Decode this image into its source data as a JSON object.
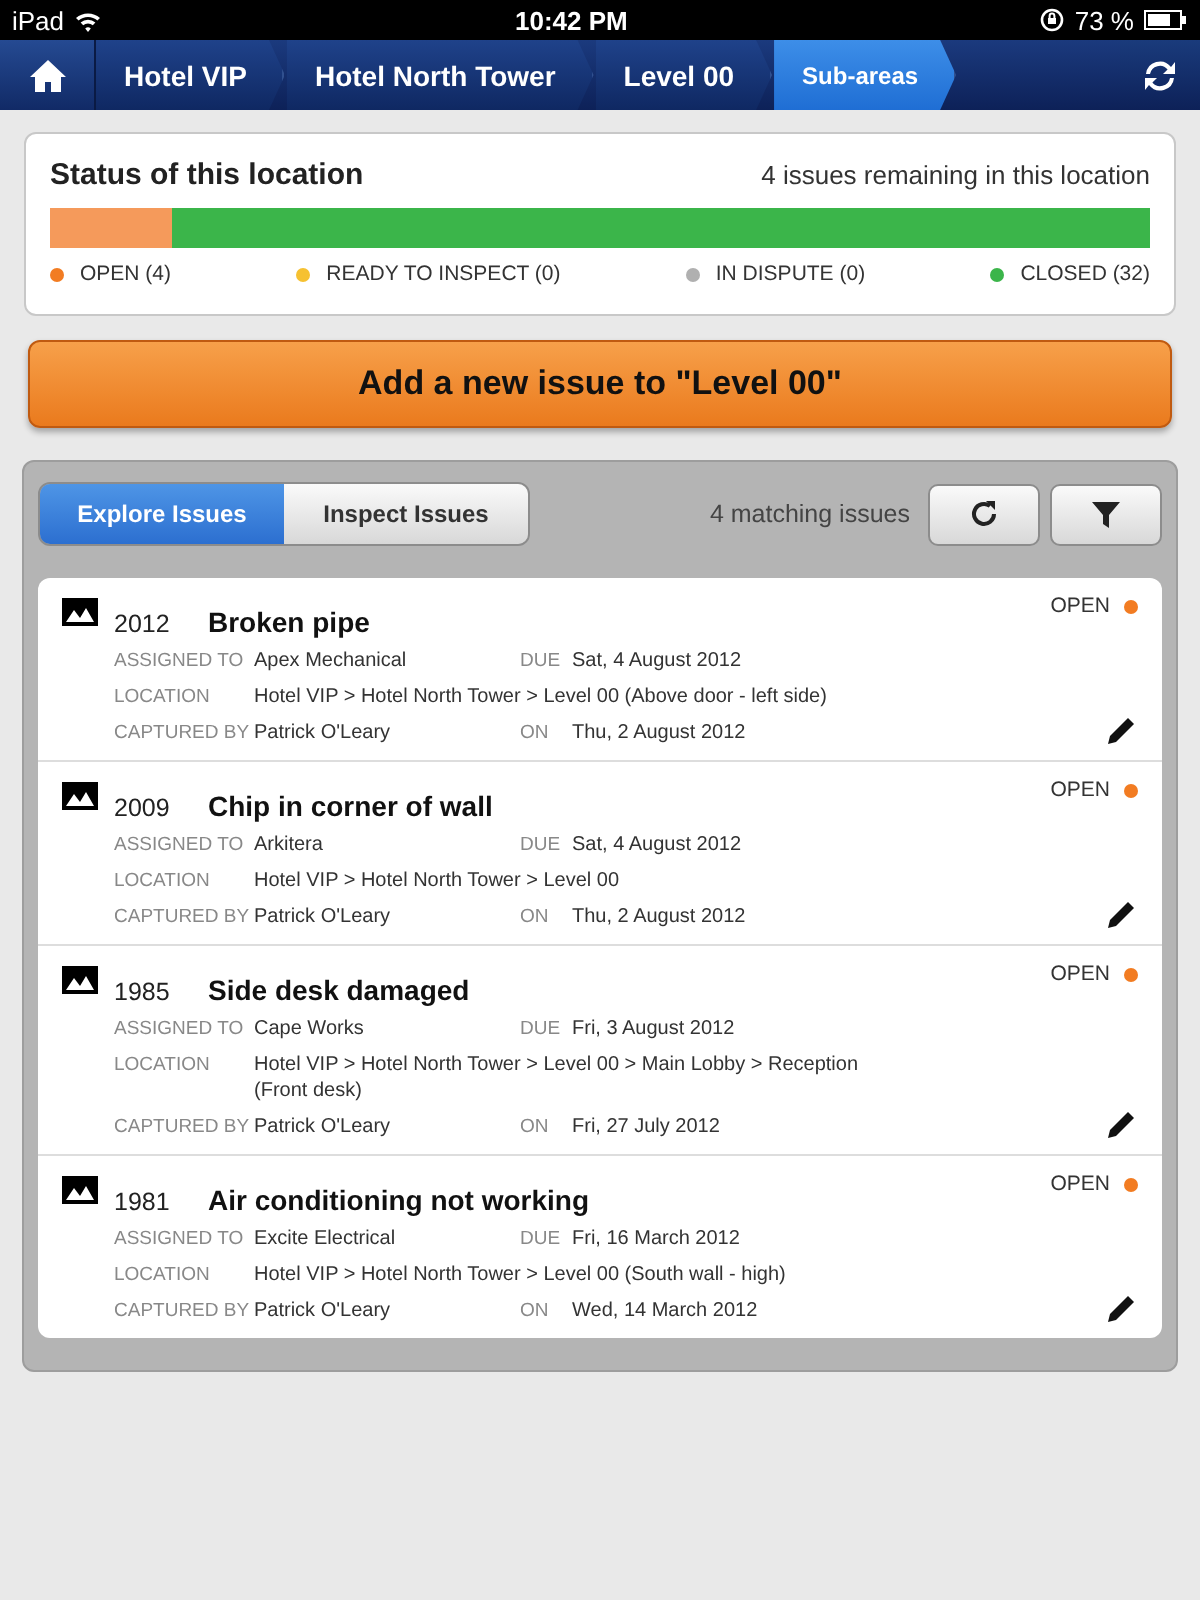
{
  "status_bar": {
    "carrier": "iPad",
    "time": "10:42 PM",
    "battery": "73 %"
  },
  "breadcrumbs": [
    {
      "label": "Hotel VIP",
      "selected": false
    },
    {
      "label": "Hotel North Tower",
      "selected": false
    },
    {
      "label": "Level 00",
      "selected": false
    },
    {
      "label": "Sub-areas",
      "selected": true
    }
  ],
  "status_card": {
    "title": "Status of this location",
    "summary": "4 issues remaining in this location",
    "open_bar": {
      "level": 0.11
    },
    "legend": [
      {
        "label": "OPEN (4)",
        "color": "#f27c22"
      },
      {
        "label": "READY TO INSPECT (0)",
        "color": "#f6c131"
      },
      {
        "label": "IN DISPUTE (0)",
        "color": "#b0b0b0"
      },
      {
        "label": "CLOSED (32)",
        "color": "#3bb54a"
      }
    ]
  },
  "add_button": "Add a new issue to \"Level 00\"",
  "tabs": [
    {
      "label": "Explore Issues",
      "selected": true
    },
    {
      "label": "Inspect Issues",
      "selected": false
    }
  ],
  "match_count": "4 matching issues",
  "issues": [
    {
      "number": "2012",
      "title": "Broken pipe",
      "assigned_label": "ASSIGNED TO",
      "assigned_to": "Apex Mechanical",
      "due_label": "DUE",
      "due": "Sat, 4 August 2012",
      "location_label": "LOCATION",
      "location": "Hotel VIP > Hotel North Tower > Level 00 (Above door - left side)",
      "captured_label": "CAPTURED BY",
      "captured_by": "Patrick O'Leary",
      "on_label": "ON",
      "on": "Thu, 2 August 2012",
      "status": "OPEN",
      "color": "#f27c22"
    },
    {
      "number": "2009",
      "title": "Chip in corner of wall",
      "assigned_label": "ASSIGNED TO",
      "assigned_to": "Arkitera",
      "due_label": "DUE",
      "due": "Sat, 4 August 2012",
      "location_label": "LOCATION",
      "location": "Hotel VIP > Hotel North Tower > Level 00",
      "captured_label": "CAPTURED BY",
      "captured_by": "Patrick O'Leary",
      "on_label": "ON",
      "on": "Thu, 2 August 2012",
      "status": "OPEN",
      "color": "#f27c22"
    },
    {
      "number": "1985",
      "title": "Side desk damaged",
      "assigned_label": "ASSIGNED TO",
      "assigned_to": "Cape Works",
      "due_label": "DUE",
      "due": "Fri, 3 August 2012",
      "location_label": "LOCATION",
      "location": "Hotel VIP > Hotel North Tower > Level 00 > Main Lobby > Reception (Front desk)",
      "captured_label": "CAPTURED BY",
      "captured_by": "Patrick O'Leary",
      "on_label": "ON",
      "on": "Fri, 27 July 2012",
      "status": "OPEN",
      "color": "#f27c22"
    },
    {
      "number": "1981",
      "title": "Air conditioning not working",
      "assigned_label": "ASSIGNED TO",
      "assigned_to": "Excite Electrical",
      "due_label": "DUE",
      "due": "Fri, 16 March 2012",
      "location_label": "LOCATION",
      "location": "Hotel VIP > Hotel North Tower > Level 00 (South wall - high)",
      "captured_label": "CAPTURED BY",
      "captured_by": "Patrick O'Leary",
      "on_label": "ON",
      "on": "Wed, 14 March 2012",
      "status": "OPEN",
      "color": "#f27c22"
    }
  ]
}
